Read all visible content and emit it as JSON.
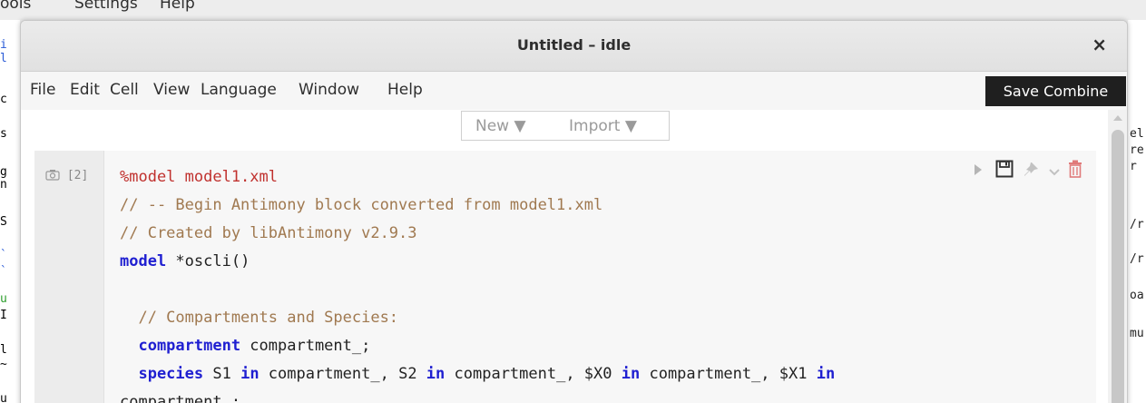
{
  "background_app": {
    "menu": [
      "ools",
      "Settings",
      "Help"
    ],
    "left_fragments": [
      "i",
      "l",
      "c",
      "s",
      "g",
      "n",
      "S",
      "`",
      "`",
      "u",
      "I",
      "l",
      "~",
      "u"
    ],
    "right_fragments": [
      "el",
      "re",
      "r",
      "/r",
      "/r",
      "oa",
      "mu"
    ]
  },
  "window": {
    "title": "Untitled – idle",
    "close_label": "×"
  },
  "menubar": [
    "File",
    "Edit",
    "Cell",
    "View",
    "Language",
    "Window",
    "Help"
  ],
  "toolbar": {
    "new_label": "New ▼",
    "import_label": "Import ▼"
  },
  "cell": {
    "prompt": "[2]",
    "lines": {
      "l1_magic": "%model model1.xml",
      "l2_comment": "// -- Begin Antimony block converted from model1.xml",
      "l3_comment": "// Created by libAntimony v2.9.3",
      "l4_kw": "model",
      "l4_rest": " *oscli()",
      "l6_comment": "  // Compartments and Species:",
      "l7_kw": "  compartment",
      "l7_rest": " compartment_;",
      "l8_kw_species": "  species",
      "l8_a": " S1 ",
      "l8_in1": "in",
      "l8_b": " compartment_, S2 ",
      "l8_in2": "in",
      "l8_c": " compartment_, $X0 ",
      "l8_in3": "in",
      "l8_d": " compartment_, $X1 ",
      "l8_in4": "in",
      "l9": "compartment_;"
    }
  },
  "tooltip": "Save Combine"
}
